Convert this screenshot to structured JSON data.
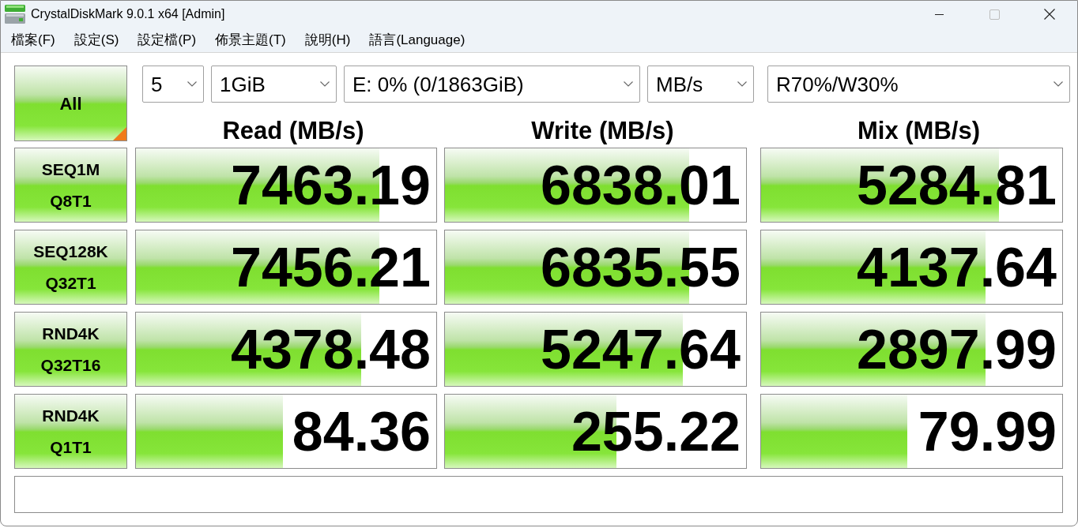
{
  "window": {
    "title": "CrystalDiskMark 9.0.1 x64 [Admin]"
  },
  "menu": [
    "檔案(F)",
    "設定(S)",
    "設定檔(P)",
    "佈景主題(T)",
    "說明(H)",
    "語言(Language)"
  ],
  "toolbar": {
    "all_button": "All",
    "selectors": [
      "5",
      "1GiB",
      "E: 0% (0/1863GiB)",
      "MB/s",
      "R70%/W30%"
    ]
  },
  "columns": [
    "Read (MB/s)",
    "Write (MB/s)",
    "Mix (MB/s)"
  ],
  "rows": [
    {
      "test": "SEQ1M",
      "params": "Q8T1",
      "results": [
        {
          "value": "7463.19",
          "level": 0.81
        },
        {
          "value": "6838.01",
          "level": 0.81
        },
        {
          "value": "5284.81",
          "level": 0.79
        }
      ]
    },
    {
      "test": "SEQ128K",
      "params": "Q32T1",
      "results": [
        {
          "value": "7456.21",
          "level": 0.81
        },
        {
          "value": "6835.55",
          "level": 0.81
        },
        {
          "value": "4137.64",
          "level": 0.745
        }
      ]
    },
    {
      "test": "RND4K",
      "params": "Q32T16",
      "results": [
        {
          "value": "4378.48",
          "level": 0.75
        },
        {
          "value": "5247.64",
          "level": 0.79
        },
        {
          "value": "2897.99",
          "level": 0.745
        }
      ]
    },
    {
      "test": "RND4K",
      "params": "Q1T1",
      "results": [
        {
          "value": "84.36",
          "level": 0.49
        },
        {
          "value": "255.22",
          "level": 0.57
        },
        {
          "value": "79.99",
          "level": 0.485
        }
      ]
    }
  ]
}
